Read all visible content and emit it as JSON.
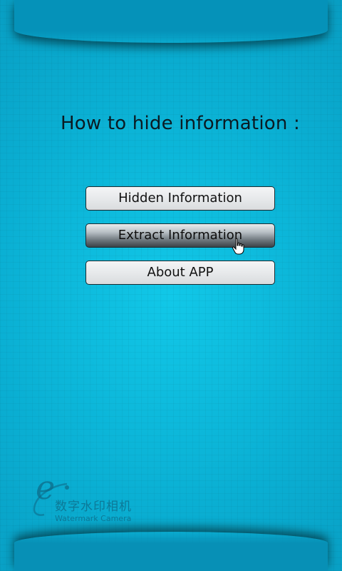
{
  "heading": "How to hide information :",
  "buttons": {
    "hidden": "Hidden Information",
    "extract": "Extract Information",
    "about": "About APP"
  },
  "logo": {
    "chinese": "数字水印相机",
    "english": "Watermark Camera"
  },
  "colors": {
    "background": "#0aaed2",
    "button_face": "#e6e8ea",
    "button_pressed": "#6e777d"
  }
}
